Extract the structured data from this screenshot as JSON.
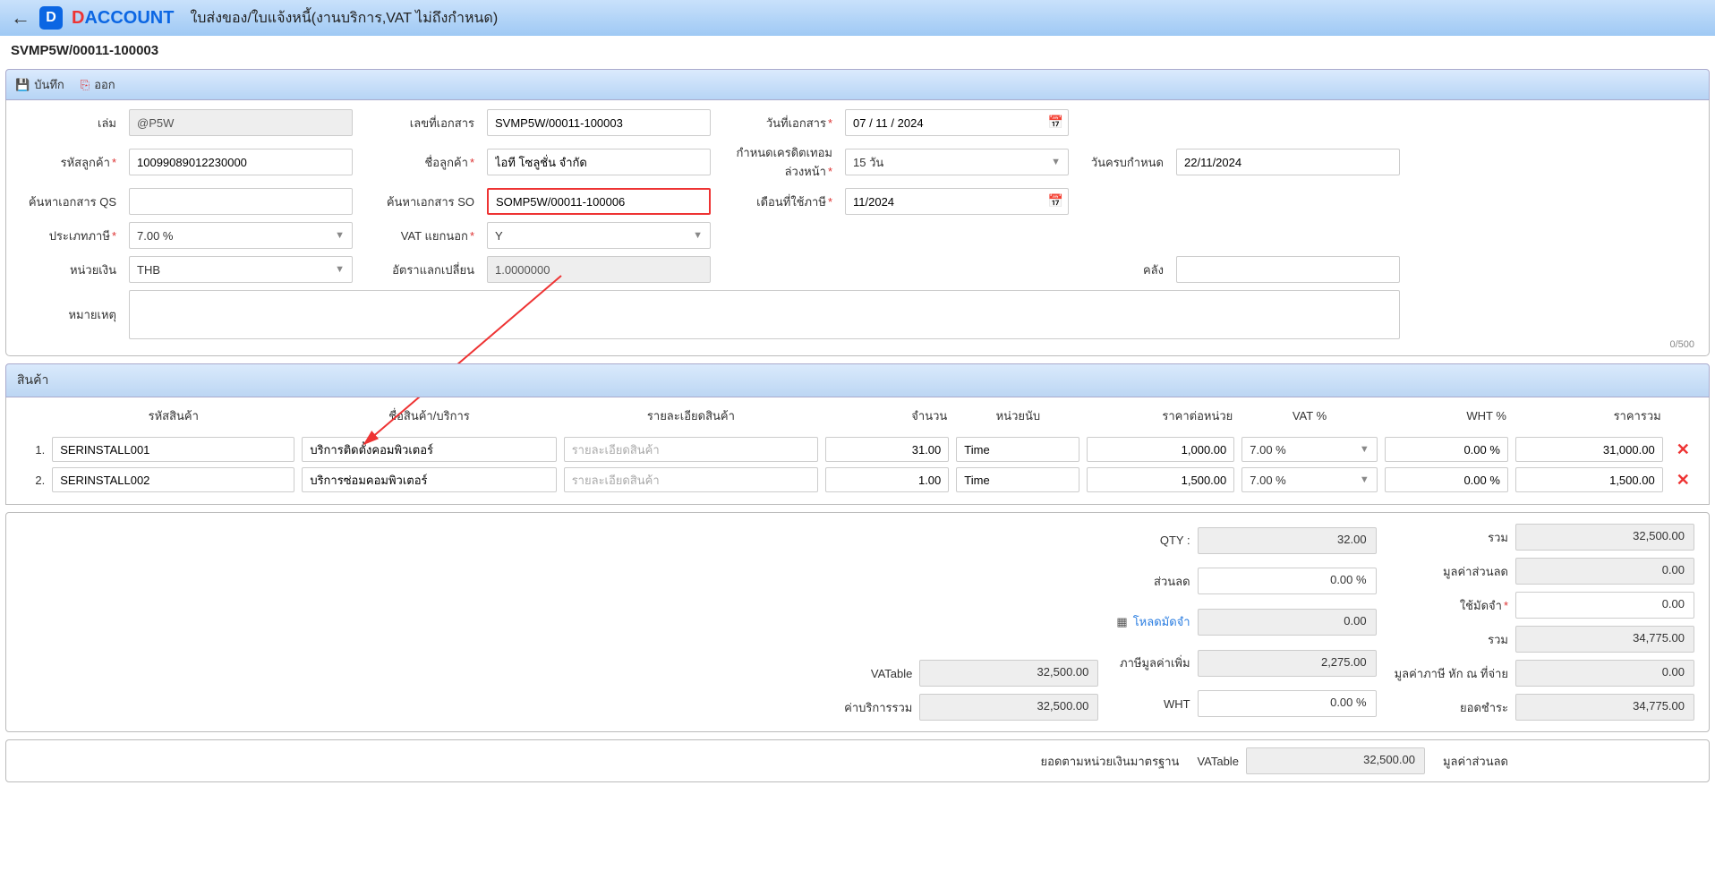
{
  "header": {
    "page_title": "ใบส่งของ/ใบแจ้งหนี้(งานบริการ,VAT ไม่ถึงกำหนด)",
    "doc_number": "SVMP5W/00011-100003"
  },
  "toolbar": {
    "save_label": "บันทึก",
    "exit_label": "ออก"
  },
  "form": {
    "book_label": "เล่ม",
    "book_value": "@P5W",
    "docno_label": "เลขที่เอกสาร",
    "docno_value": "SVMP5W/00011-100003",
    "docdate_label": "วันที่เอกสาร",
    "docdate_value": "07 / 11 / 2024",
    "custcode_label": "รหัสลูกค้า",
    "custcode_value": "10099089012230000",
    "custname_label": "ชื่อลูกค้า",
    "custname_value": "ไอที โซลูชั่น จำกัด",
    "credit_label": "กำหนดเครดิตเทอมล่วงหน้า",
    "credit_value": "15 วัน",
    "duedate_label": "วันครบกำหนด",
    "duedate_value": "22/11/2024",
    "searchqs_label": "ค้นหาเอกสาร QS",
    "searchqs_value": "",
    "searchso_label": "ค้นหาเอกสาร SO",
    "searchso_value": "SOMP5W/00011-100006",
    "taxmonth_label": "เดือนที่ใช้ภาษี",
    "taxmonth_value": "11/2024",
    "vattype_label": "ประเภทภาษี",
    "vattype_value": "7.00 %",
    "vatsep_label": "VAT แยกนอก",
    "vatsep_value": "Y",
    "currency_label": "หน่วยเงิน",
    "currency_value": "THB",
    "exrate_label": "อัตราแลกเปลี่ยน",
    "exrate_value": "1.0000000",
    "warehouse_label": "คลัง",
    "warehouse_value": "",
    "remark_label": "หมายเหตุ",
    "remark_value": "",
    "charcount": "0/500"
  },
  "items_section_title": "สินค้า",
  "items_headers": {
    "code": "รหัสสินค้า",
    "name": "ชื่อสินค้า/บริการ",
    "detail": "รายละเอียดสินค้า",
    "qty": "จำนวน",
    "unit": "หน่วยนับ",
    "unitprice": "ราคาต่อหน่วย",
    "vat": "VAT %",
    "wht": "WHT %",
    "total": "ราคารวม"
  },
  "detail_placeholder": "รายละเอียดสินค้า",
  "items": [
    {
      "code": "SERINSTALL001",
      "name": "บริการติดตั้งคอมพิวเตอร์",
      "qty": "31.00",
      "unit": "Time",
      "unitprice": "1,000.00",
      "vat": "7.00 %",
      "wht": "0.00 %",
      "total": "31,000.00"
    },
    {
      "code": "SERINSTALL002",
      "name": "บริการซ่อมคอมพิวเตอร์",
      "qty": "1.00",
      "unit": "Time",
      "unitprice": "1,500.00",
      "vat": "7.00 %",
      "wht": "0.00 %",
      "total": "1,500.00"
    }
  ],
  "totals": {
    "col1": {
      "vatable_label": "VATable",
      "vatable_value": "32,500.00",
      "servicetotal_label": "ค่าบริการรวม",
      "servicetotal_value": "32,500.00"
    },
    "col2": {
      "qty_label": "QTY :",
      "qty_value": "32.00",
      "discount_label": "ส่วนลด",
      "discount_value": "0.00 %",
      "loaddeposit_label": "โหลดมัดจำ",
      "loaddeposit_value": "0.00",
      "vat_label": "ภาษีมูลค่าเพิ่ม",
      "vat_value": "2,275.00",
      "wht_label": "WHT",
      "wht_value": "0.00 %"
    },
    "col3": {
      "sum_label": "รวม",
      "sum_value": "32,500.00",
      "discamt_label": "มูลค่าส่วนลด",
      "discamt_value": "0.00",
      "usedeposit_label": "ใช้มัดจำ",
      "usedeposit_value": "0.00",
      "grand_label": "รวม",
      "grand_value": "34,775.00",
      "whtamt_label": "มูลค่าภาษี หัก ณ ที่จ่าย",
      "whtamt_value": "0.00",
      "netpay_label": "ยอดชำระ",
      "netpay_value": "34,775.00"
    }
  },
  "footer": {
    "std_label": "ยอดตามหน่วยเงินมาตรฐาน",
    "vatable_label": "VATable",
    "vatable_value": "32,500.00",
    "discamt_label": "มูลค่าส่วนลด"
  }
}
